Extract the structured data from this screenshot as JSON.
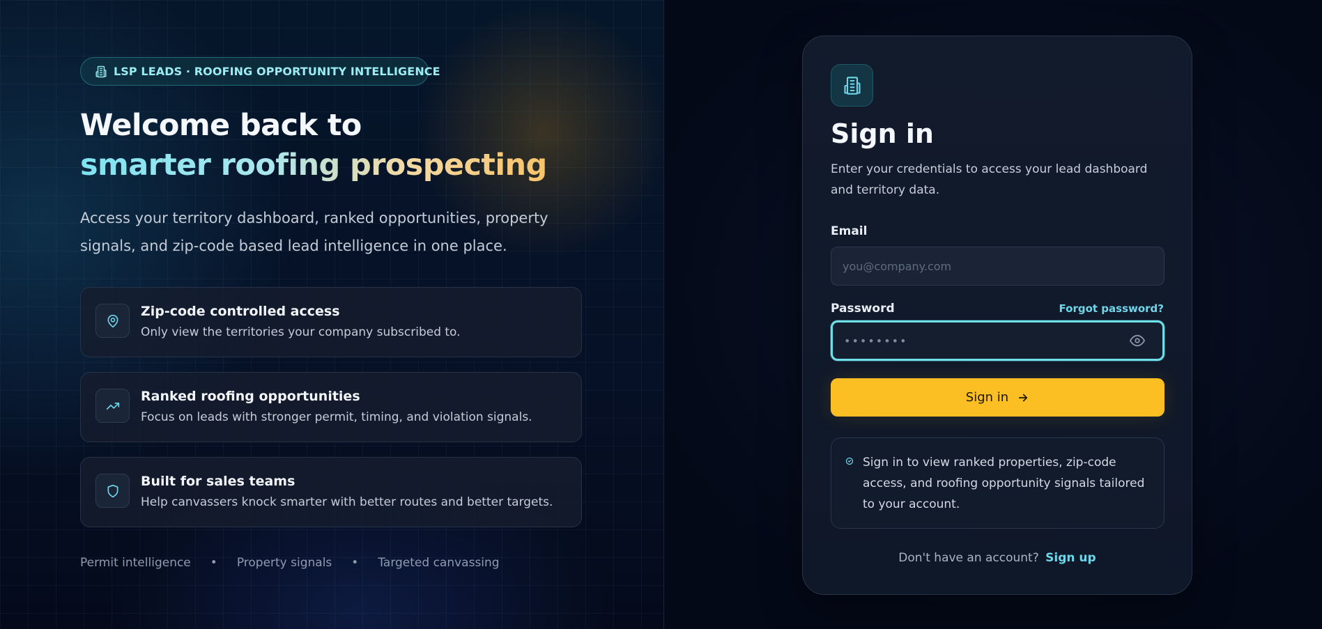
{
  "hero": {
    "badge": "LSP LEADS · ROOFING OPPORTUNITY INTELLIGENCE",
    "badge_icon": "building-icon",
    "headline_line1": "Welcome back to",
    "headline_line2": "smarter roofing prospecting",
    "subtext": "Access your territory dashboard, ranked opportunities, property signals, and zip-code based lead intelligence in one place."
  },
  "features": [
    {
      "icon": "map-pin-icon",
      "title": "Zip-code controlled access",
      "description": "Only view the territories your company subscribed to."
    },
    {
      "icon": "trending-up-icon",
      "title": "Ranked roofing opportunities",
      "description": "Focus on leads with stronger permit, timing, and violation signals."
    },
    {
      "icon": "shield-icon",
      "title": "Built for sales teams",
      "description": "Help canvassers knock smarter with better routes and better targets."
    }
  ],
  "tags": [
    "Permit intelligence",
    "Property signals",
    "Targeted canvassing"
  ],
  "tag_separator": "•",
  "signin": {
    "logo_icon": "building-icon",
    "title": "Sign in",
    "description": "Enter your credentials to access your lead dashboard and territory data.",
    "email_label": "Email",
    "email_placeholder": "you@company.com",
    "password_label": "Password",
    "forgot_label": "Forgot password?",
    "password_value": "••••••••",
    "button_label": "Sign in",
    "info_text": "Sign in to view ranked properties, zip-code access, and roofing opportunity signals tailored to your account.",
    "signup_prompt": "Don't have an account?",
    "signup_link": "Sign up"
  },
  "colors": {
    "accent_cyan": "#6fdfe9",
    "accent_yellow": "#fbbf24",
    "background": "#050b1a"
  }
}
